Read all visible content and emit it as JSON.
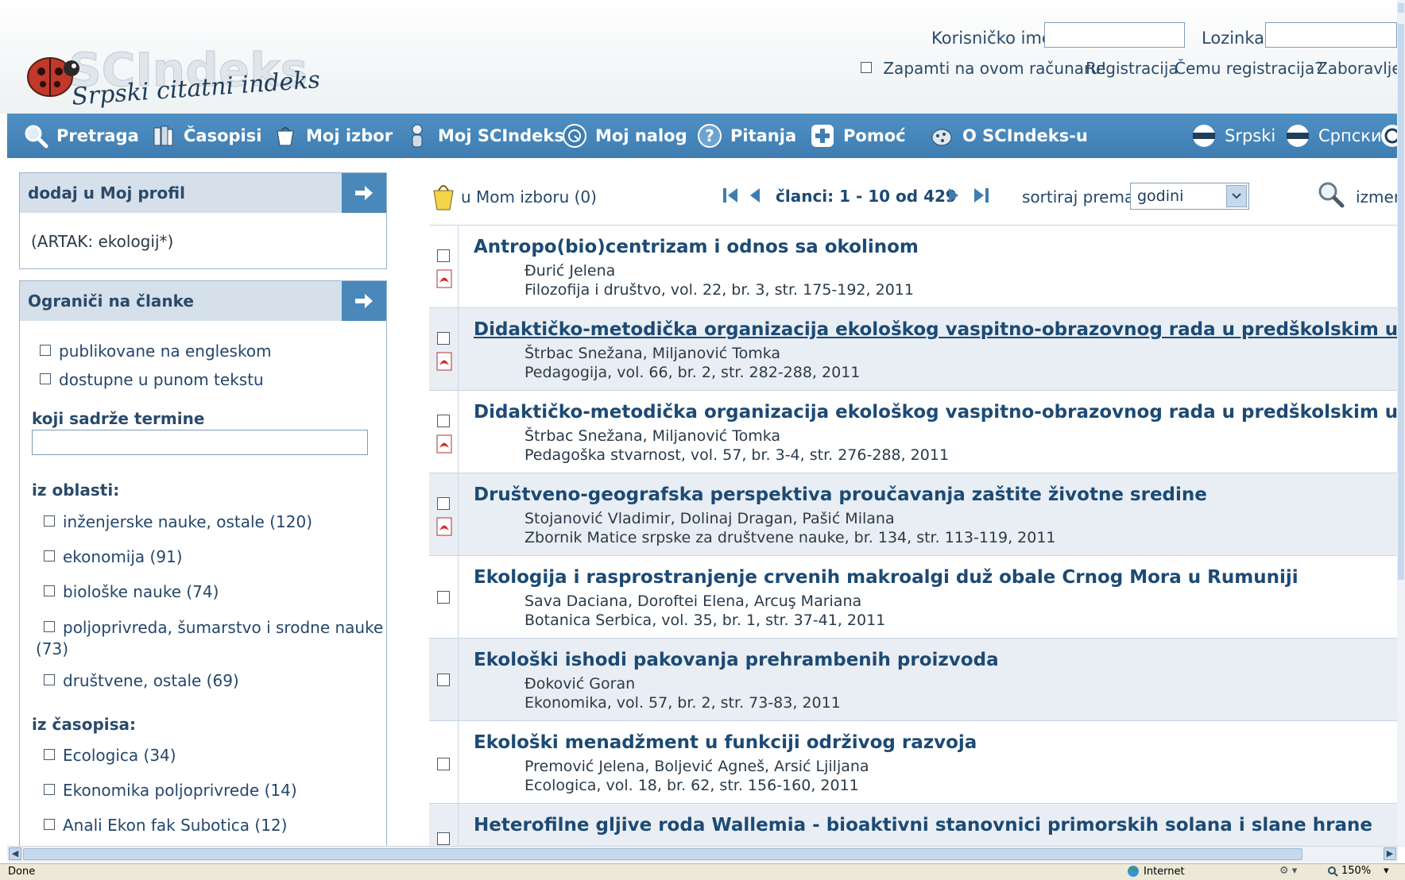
{
  "login": {
    "username_label": "Korisničko ime:",
    "password_label": "Lozinka:",
    "username_value": "",
    "password_value": "",
    "remember_label": "Zapamti na ovom računaru!",
    "register_link": "Registracija",
    "why_register_link": "Čemu registracija?",
    "forgot_link": "Zaboravljer"
  },
  "logo": {
    "text": "Srpski citatni indeks",
    "brand": "SCIndeks"
  },
  "nav": {
    "items": [
      {
        "label": "Pretraga",
        "icon": "magnifier-icon"
      },
      {
        "label": "Časopisi",
        "icon": "books-icon"
      },
      {
        "label": "Moj izbor",
        "icon": "selection-icon"
      },
      {
        "label": "Moj SCIndeks",
        "icon": "person-icon"
      },
      {
        "label": "Moj nalog",
        "icon": "account-icon"
      },
      {
        "label": "Pitanja",
        "icon": "question-icon"
      },
      {
        "label": "Pomoć",
        "icon": "help-cross-icon"
      },
      {
        "label": "O SCIndeks-u",
        "icon": "info-icon"
      }
    ],
    "languages": [
      "Srpski",
      "Српски"
    ]
  },
  "profile_panel": {
    "title": "dodaj u Moj profil",
    "query": "(ARTAK: ekologij*)"
  },
  "limit_panel": {
    "title": "Ograniči na članke",
    "options": [
      "publikovane na engleskom",
      "dostupne u punom tekstu"
    ],
    "terms_label": "koji sadrže termine",
    "terms_value": "",
    "areas_label": "iz oblasti:",
    "areas": [
      "inženjerske nauke, ostale (120)",
      "ekonomija (91)",
      "biološke nauke (74)",
      "poljoprivreda, šumarstvo i srodne nauke",
      "(73)",
      "društvene, ostale (69)"
    ],
    "journals_label": "iz časopisa:",
    "journals": [
      "Ecologica (34)",
      "Ekonomika poljoprivrede (14)",
      "Anali Ekon fak Subotica (12)"
    ]
  },
  "results_bar": {
    "my_selection": "u Mom izboru (0)",
    "range": "članci: 1 - 10 od 429",
    "sort_label": "sortiraj prema:",
    "sort_value": "godini",
    "change_label": "izmer"
  },
  "results": [
    {
      "title": "Antropo(bio)centrizam i odnos sa okolinom",
      "authors": "Đurić Jelena",
      "source": "Filozofija i društvo, vol. 22, br. 3, str. 175-192, 2011",
      "pdf": true
    },
    {
      "title": "Didaktičko-metodička organizacija ekološkog vaspitno-obrazovnog rada u predškolskim ustanovam",
      "authors": "Štrbac Snežana, Miljanović Tomka",
      "source": "Pedagogija, vol. 66, br. 2, str. 282-288, 2011",
      "pdf": true
    },
    {
      "title": "Didaktičko-metodička organizacija ekološkog vaspitno-obrazovnog rada u predškolskim ustanovam",
      "authors": "Štrbac Snežana, Miljanović Tomka",
      "source": "Pedagoška stvarnost, vol. 57, br. 3-4, str. 276-288, 2011",
      "pdf": true
    },
    {
      "title": "Društveno-geografska perspektiva proučavanja zaštite životne sredine",
      "authors": "Stojanović Vladimir, Dolinaj Dragan, Pašić Milana",
      "source": "Zbornik Matice srpske za društvene nauke, br. 134, str. 113-119, 2011",
      "pdf": true
    },
    {
      "title": "Ekologija i rasprostranjenje crvenih makroalgi duž obale Crnog Mora u Rumuniji",
      "authors": "Sava Daciana, Doroftei Elena, Arcuş Mariana",
      "source": "Botanica Serbica, vol. 35, br. 1, str. 37-41, 2011",
      "pdf": false
    },
    {
      "title": "Ekološki ishodi pakovanja prehrambenih proizvoda",
      "authors": "Đoković Goran",
      "source": "Ekonomika, vol. 57, br. 2, str. 73-83, 2011",
      "pdf": false
    },
    {
      "title": "Ekološki menadžment u funkciji održivog razvoja",
      "authors": "Premović Jelena, Boljević Agneš, Arsić Ljiljana",
      "source": "Ecologica, vol. 18, br. 62, str. 156-160, 2011",
      "pdf": false
    },
    {
      "title": "Heterofilne gljive roda Wallemia - bioaktivni stanovnici primorskih solana i slane hrane",
      "authors": "",
      "source": "",
      "pdf": false
    }
  ],
  "status": {
    "text": "Done",
    "zone": "Internet",
    "zoom": "150%"
  },
  "colors": {
    "nav_bg": "#4a88bc",
    "panel_head": "#d5e0ea",
    "title": "#1c4a74",
    "alt_row": "#e9eef4"
  }
}
